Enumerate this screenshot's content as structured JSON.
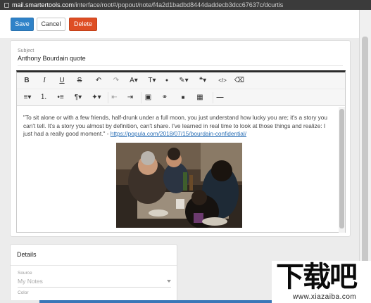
{
  "browser": {
    "url_host": "mail.smartertools.com",
    "url_path": "/interface/root#/popout/note/f4a2d1badbd8444daddecb3dcc67637c/dcurtis"
  },
  "actions": {
    "save_label": "Save",
    "cancel_label": "Cancel",
    "delete_label": "Delete"
  },
  "note": {
    "subject_label": "Subject",
    "subject_value": "Anthony Bourdain quote",
    "body_text": "\"To sit alone or with a few friends, half-drunk under a full moon, you just understand how lucky you are; it's a story you can't tell. It's a story you almost by definition, can't share. I've learned in real time to look at those things and realize: I just had a really good moment.\" - ",
    "body_link": "https://popula.com/2018/07/15/bourdain-confidential/"
  },
  "editor_toolbar": {
    "row1": [
      {
        "name": "bold-icon",
        "glyph": "B"
      },
      {
        "name": "italic-icon",
        "glyph": "I"
      },
      {
        "name": "underline-icon",
        "glyph": "U"
      },
      {
        "name": "strikethrough-icon",
        "glyph": "S"
      },
      {
        "name": "undo-icon",
        "glyph": "↶"
      },
      {
        "name": "redo-icon",
        "glyph": "↷"
      },
      {
        "name": "font-color-icon",
        "glyph": "A▾"
      },
      {
        "name": "font-size-icon",
        "glyph": "T▾"
      },
      {
        "name": "ink-drop-icon",
        "glyph": "●"
      },
      {
        "name": "paintbrush-icon",
        "glyph": "✎▾"
      },
      {
        "name": "quote-icon",
        "glyph": "❝▾"
      },
      {
        "name": "code-icon",
        "glyph": "</>"
      },
      {
        "name": "eraser-icon",
        "glyph": "⌫"
      }
    ],
    "row2": [
      {
        "name": "align-icon",
        "glyph": "≡▾"
      },
      {
        "name": "ordered-list-icon",
        "glyph": "⒈"
      },
      {
        "name": "unordered-list-icon",
        "glyph": "•≡"
      },
      {
        "name": "paragraph-icon",
        "glyph": "¶▾"
      },
      {
        "name": "magic-wand-icon",
        "glyph": "✦▾"
      },
      {
        "name": "outdent-icon",
        "glyph": "⇤"
      },
      {
        "name": "indent-icon",
        "glyph": "⇥"
      },
      {
        "name": "image-icon",
        "glyph": "▣"
      },
      {
        "name": "link-icon",
        "glyph": "⚭"
      },
      {
        "name": "video-icon",
        "glyph": "■"
      },
      {
        "name": "table-icon",
        "glyph": "▦"
      },
      {
        "name": "horizontal-rule-icon",
        "glyph": "—"
      }
    ]
  },
  "details": {
    "title": "Details",
    "source_label": "Source",
    "source_value": "My Notes",
    "color_label": "Color"
  },
  "watermark": {
    "big_text": "下载吧",
    "small_text": "www.xiazaiba.com"
  },
  "colors": {
    "save": "#2f82c8",
    "delete": "#de4e24",
    "link": "#2a6fb5"
  }
}
